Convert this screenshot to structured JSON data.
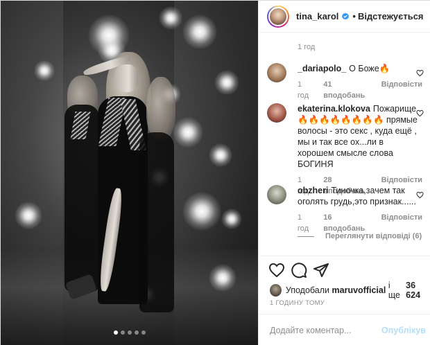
{
  "author": {
    "username": "tina_karol",
    "follow_label": "Відстежується",
    "separator": "•"
  },
  "caption_time": "1 год",
  "comments": [
    {
      "username": "_dariapolo_",
      "text": "О Боже🔥",
      "time": "1 год",
      "likes": "41 вподобань",
      "reply": "Відповісти"
    },
    {
      "username": "ekaterina.klokova",
      "text": "Пожарище 🔥🔥🔥🔥🔥🔥🔥🔥 прямые волосы - это секс , куда ещё , мы и так все ох...ли в хорошем смысле слова БОГИНЯ",
      "time": "1 год",
      "likes": "28 вподобань",
      "reply": "Відповісти"
    },
    {
      "username": "obzheri",
      "text": "Тиночка,зачем так оголять грудь,это признак......",
      "time": "1 год",
      "likes": "16 вподобань",
      "reply": "Відповісти"
    }
  ],
  "view_replies": "Переглянути відповіді (6)",
  "likes_line": {
    "prefix": "Уподобали",
    "user": "maruvofficial",
    "connector": "і ще",
    "count": "36 624"
  },
  "post_time": "1 ГОДИНУ ТОМУ",
  "comment_input": {
    "placeholder": "Додайте коментар...",
    "value": ""
  },
  "publish_label": "Опублікув",
  "carousel": {
    "count": 5,
    "active": 0
  },
  "colors": {
    "verified": "#3897f0",
    "link_disabled": "#b2dffc",
    "muted": "#8e8e8e"
  },
  "icons": [
    "verified-badge-icon",
    "heart-icon",
    "comment-icon",
    "share-icon"
  ]
}
